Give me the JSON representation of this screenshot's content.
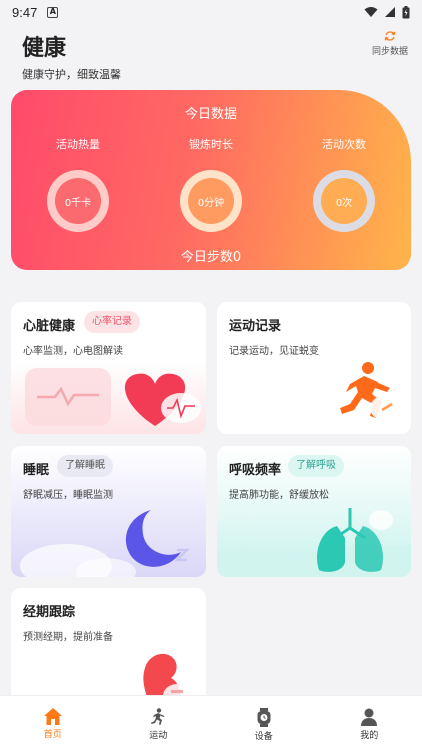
{
  "status_bar": {
    "time": "9:47",
    "notification_letter": "A"
  },
  "header": {
    "title": "健康",
    "subtitle": "健康守护，细致温馨",
    "sync_label": "同步数据"
  },
  "today": {
    "title": "今日数据",
    "metrics": [
      {
        "label": "活动热量",
        "value": "0千卡"
      },
      {
        "label": "锻炼时长",
        "value": "0分钟"
      },
      {
        "label": "活动次数",
        "value": "0次"
      }
    ],
    "steps_label": "今日步数0"
  },
  "cards": {
    "heart": {
      "title": "心脏健康",
      "tag": "心率记录",
      "desc": "心率监测，心电图解读"
    },
    "sport": {
      "title": "运动记录",
      "desc": "记录运动，见证蜕变"
    },
    "sleep": {
      "title": "睡眠",
      "tag": "了解睡眠",
      "desc": "舒眠减压，睡眠监测"
    },
    "breath": {
      "title": "呼吸频率",
      "tag": "了解呼吸",
      "desc": "提高肺功能，舒缓放松"
    },
    "period": {
      "title": "经期跟踪",
      "desc": "预测经期，提前准备"
    }
  },
  "tab_bar": {
    "items": [
      {
        "label": "首页",
        "icon": "home-icon",
        "active": true
      },
      {
        "label": "运动",
        "icon": "running-icon",
        "active": false
      },
      {
        "label": "设备",
        "icon": "watch-icon",
        "active": false
      },
      {
        "label": "我的",
        "icon": "user-icon",
        "active": false
      }
    ]
  },
  "colors": {
    "accent": "#ff7a17",
    "card_gradient_start": "#ff4a6b",
    "card_gradient_end": "#ffb54a"
  }
}
